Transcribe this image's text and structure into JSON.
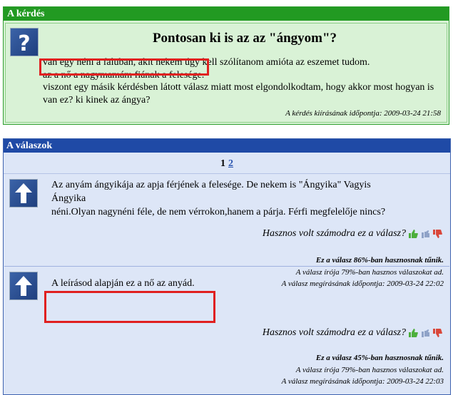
{
  "question": {
    "header": "A kérdés",
    "title": "Pontosan ki is az az \"ángyom\"?",
    "lines": [
      "van egy néni a faluban, akit nekem úgy kell szólítanom amióta az eszemet tudom.",
      "az a nő a nagymamám fiának a felesége.",
      "viszont egy másik kérdésben látott válasz miatt most elgondolkodtam, hogy akkor most hogyan is",
      "van ez? ki kinek az ángya?"
    ],
    "meta": "A kérdés kiírásának időpontja: 2009-03-24 21:58",
    "icon": "question-mark-icon"
  },
  "answers_section": {
    "header": "A válaszok",
    "pager": {
      "current": "1",
      "next": "2"
    }
  },
  "answers": [
    {
      "text_lines": [
        "Az anyám ángyikája az apja férjének a felesége. De nekem is \"Ángyika\" Vagyis Ángyika",
        "néni.Olyan nagynéni féle, de nem vérrokon,hanem a párja. Férfi megfelelője nincs?"
      ],
      "helpful_prompt": "Hasznos volt számodra ez a válasz?",
      "stat1": "Ez a válasz 86%-ban hasznosnak tűnik.",
      "stat2": "A válasz írója 79%-ban hasznos válaszokat ad.",
      "stat3": "A válasz megírásának időpontja: 2009-03-24 22:02",
      "icon": "up-arrow-icon"
    },
    {
      "text_lines": [
        "A leírásod alapján ez a nő az anyád."
      ],
      "helpful_prompt": "Hasznos volt számodra ez a válasz?",
      "stat1": "Ez a válasz 45%-ban hasznosnak tűnik.",
      "stat2": "A válasz írója 79%-ban hasznos válaszokat ad.",
      "stat3": "A válasz megírásának időpontja: 2009-03-24 22:03",
      "icon": "up-arrow-icon"
    }
  ],
  "colors": {
    "question_header": "#229a22",
    "answers_header": "#1f4aa6",
    "highlight": "#e02020"
  }
}
